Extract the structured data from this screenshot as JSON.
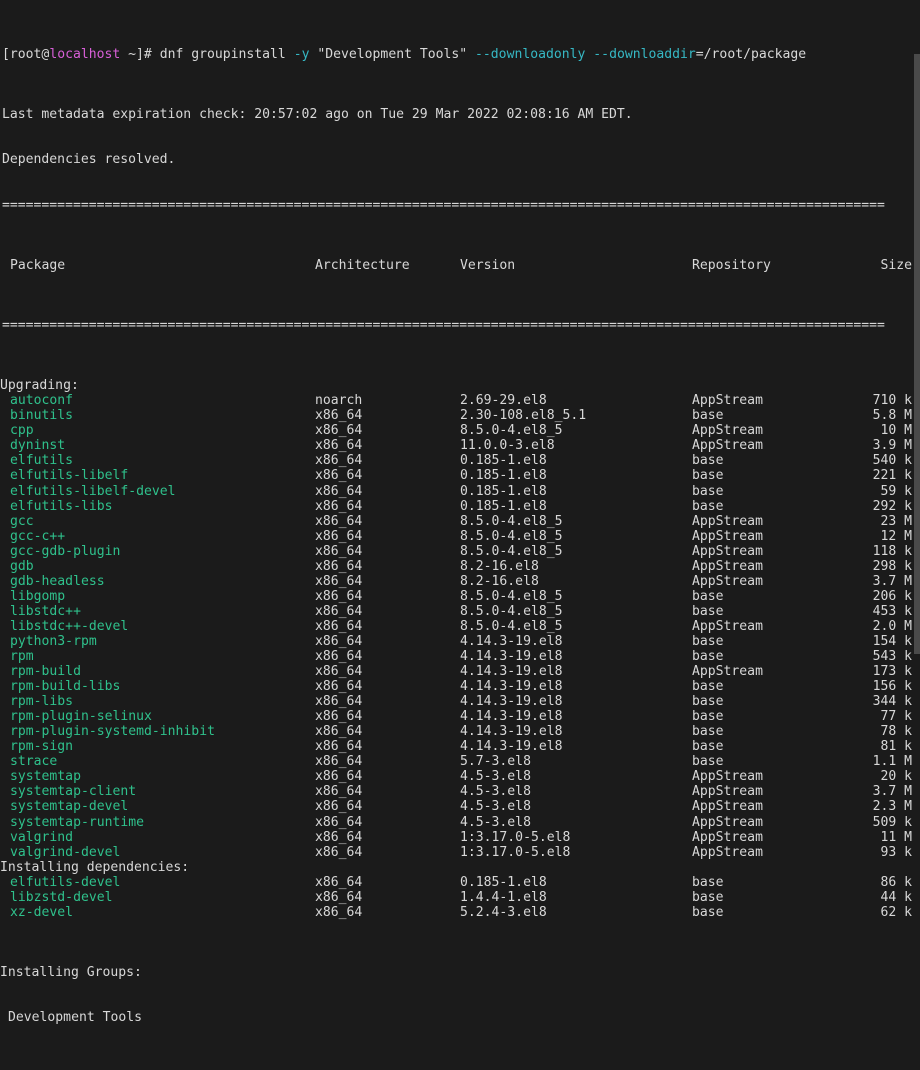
{
  "terminal": {
    "background": "#1b1b1b",
    "foreground": "#d8d8d8",
    "green": "#2fc18c",
    "cyan": "#36b8c4",
    "magenta": "#d75fd7"
  },
  "prompt": {
    "bracket_open": "[",
    "user": "root@",
    "host": "localhost",
    "path_and_sigil": " ~]# ",
    "command": "dnf groupinstall ",
    "flag_y": "-y",
    "group_arg": " \"Development Tools\" ",
    "flag_downloadonly": "--downloadonly",
    "space": " ",
    "flag_downloaddir": "--downloaddir",
    "downloaddir_value": "=/root/package"
  },
  "messages": {
    "metadata": "Last metadata expiration check: 20:57:02 ago on Tue 29 Mar 2022 02:08:16 AM EDT.",
    "resolved": "Dependencies resolved."
  },
  "rule": "================================================================================================================",
  "table": {
    "headers": {
      "package": "Package",
      "architecture": "Architecture",
      "version": "Version",
      "repository": "Repository",
      "size": "Size"
    }
  },
  "sections": [
    {
      "label": "Upgrading:",
      "rows": [
        {
          "package": "autoconf",
          "arch": "noarch",
          "version": "2.69-29.el8",
          "repo": "AppStream",
          "size": "710 k"
        },
        {
          "package": "binutils",
          "arch": "x86_64",
          "version": "2.30-108.el8_5.1",
          "repo": "base",
          "size": "5.8 M"
        },
        {
          "package": "cpp",
          "arch": "x86_64",
          "version": "8.5.0-4.el8_5",
          "repo": "AppStream",
          "size": "10 M"
        },
        {
          "package": "dyninst",
          "arch": "x86_64",
          "version": "11.0.0-3.el8",
          "repo": "AppStream",
          "size": "3.9 M"
        },
        {
          "package": "elfutils",
          "arch": "x86_64",
          "version": "0.185-1.el8",
          "repo": "base",
          "size": "540 k"
        },
        {
          "package": "elfutils-libelf",
          "arch": "x86_64",
          "version": "0.185-1.el8",
          "repo": "base",
          "size": "221 k"
        },
        {
          "package": "elfutils-libelf-devel",
          "arch": "x86_64",
          "version": "0.185-1.el8",
          "repo": "base",
          "size": "59 k"
        },
        {
          "package": "elfutils-libs",
          "arch": "x86_64",
          "version": "0.185-1.el8",
          "repo": "base",
          "size": "292 k"
        },
        {
          "package": "gcc",
          "arch": "x86_64",
          "version": "8.5.0-4.el8_5",
          "repo": "AppStream",
          "size": "23 M"
        },
        {
          "package": "gcc-c++",
          "arch": "x86_64",
          "version": "8.5.0-4.el8_5",
          "repo": "AppStream",
          "size": "12 M"
        },
        {
          "package": "gcc-gdb-plugin",
          "arch": "x86_64",
          "version": "8.5.0-4.el8_5",
          "repo": "AppStream",
          "size": "118 k"
        },
        {
          "package": "gdb",
          "arch": "x86_64",
          "version": "8.2-16.el8",
          "repo": "AppStream",
          "size": "298 k"
        },
        {
          "package": "gdb-headless",
          "arch": "x86_64",
          "version": "8.2-16.el8",
          "repo": "AppStream",
          "size": "3.7 M"
        },
        {
          "package": "libgomp",
          "arch": "x86_64",
          "version": "8.5.0-4.el8_5",
          "repo": "base",
          "size": "206 k"
        },
        {
          "package": "libstdc++",
          "arch": "x86_64",
          "version": "8.5.0-4.el8_5",
          "repo": "base",
          "size": "453 k"
        },
        {
          "package": "libstdc++-devel",
          "arch": "x86_64",
          "version": "8.5.0-4.el8_5",
          "repo": "AppStream",
          "size": "2.0 M"
        },
        {
          "package": "python3-rpm",
          "arch": "x86_64",
          "version": "4.14.3-19.el8",
          "repo": "base",
          "size": "154 k"
        },
        {
          "package": "rpm",
          "arch": "x86_64",
          "version": "4.14.3-19.el8",
          "repo": "base",
          "size": "543 k"
        },
        {
          "package": "rpm-build",
          "arch": "x86_64",
          "version": "4.14.3-19.el8",
          "repo": "AppStream",
          "size": "173 k"
        },
        {
          "package": "rpm-build-libs",
          "arch": "x86_64",
          "version": "4.14.3-19.el8",
          "repo": "base",
          "size": "156 k"
        },
        {
          "package": "rpm-libs",
          "arch": "x86_64",
          "version": "4.14.3-19.el8",
          "repo": "base",
          "size": "344 k"
        },
        {
          "package": "rpm-plugin-selinux",
          "arch": "x86_64",
          "version": "4.14.3-19.el8",
          "repo": "base",
          "size": "77 k"
        },
        {
          "package": "rpm-plugin-systemd-inhibit",
          "arch": "x86_64",
          "version": "4.14.3-19.el8",
          "repo": "base",
          "size": "78 k"
        },
        {
          "package": "rpm-sign",
          "arch": "x86_64",
          "version": "4.14.3-19.el8",
          "repo": "base",
          "size": "81 k"
        },
        {
          "package": "strace",
          "arch": "x86_64",
          "version": "5.7-3.el8",
          "repo": "base",
          "size": "1.1 M"
        },
        {
          "package": "systemtap",
          "arch": "x86_64",
          "version": "4.5-3.el8",
          "repo": "AppStream",
          "size": "20 k"
        },
        {
          "package": "systemtap-client",
          "arch": "x86_64",
          "version": "4.5-3.el8",
          "repo": "AppStream",
          "size": "3.7 M"
        },
        {
          "package": "systemtap-devel",
          "arch": "x86_64",
          "version": "4.5-3.el8",
          "repo": "AppStream",
          "size": "2.3 M"
        },
        {
          "package": "systemtap-runtime",
          "arch": "x86_64",
          "version": "4.5-3.el8",
          "repo": "AppStream",
          "size": "509 k"
        },
        {
          "package": "valgrind",
          "arch": "x86_64",
          "version": "1:3.17.0-5.el8",
          "repo": "AppStream",
          "size": "11 M"
        },
        {
          "package": "valgrind-devel",
          "arch": "x86_64",
          "version": "1:3.17.0-5.el8",
          "repo": "AppStream",
          "size": "93 k"
        }
      ]
    },
    {
      "label": "Installing dependencies:",
      "rows": [
        {
          "package": "elfutils-devel",
          "arch": "x86_64",
          "version": "0.185-1.el8",
          "repo": "base",
          "size": "86 k"
        },
        {
          "package": "libzstd-devel",
          "arch": "x86_64",
          "version": "1.4.4-1.el8",
          "repo": "base",
          "size": "44 k"
        },
        {
          "package": "xz-devel",
          "arch": "x86_64",
          "version": "5.2.4-3.el8",
          "repo": "base",
          "size": "62 k"
        }
      ]
    }
  ],
  "groups": {
    "label": "Installing Groups:",
    "items": [
      "Development Tools"
    ]
  }
}
